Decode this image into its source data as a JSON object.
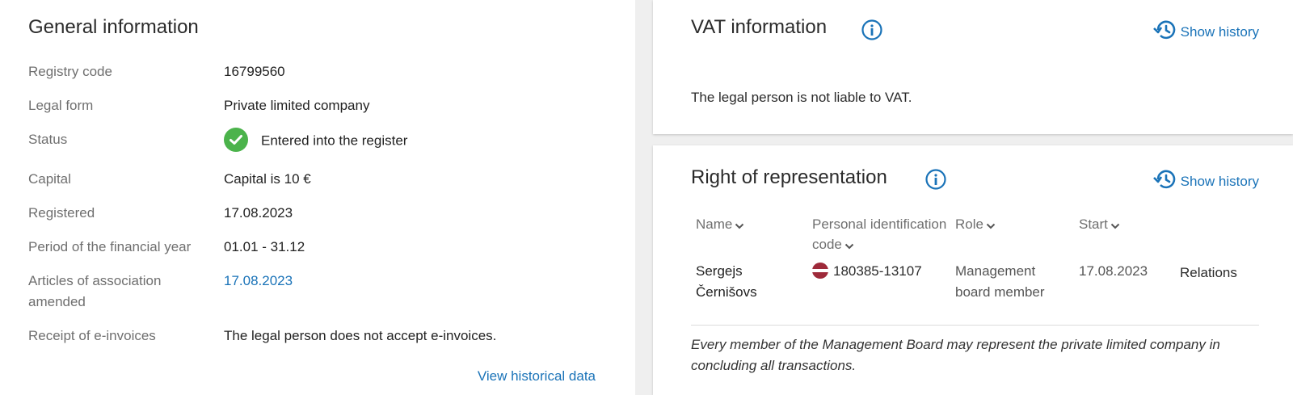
{
  "general": {
    "title": "General information",
    "rows": [
      {
        "label": "Registry code",
        "value": "16799560"
      },
      {
        "label": "Legal form",
        "value": "Private limited company"
      },
      {
        "label": "Status",
        "value": "Entered into the register"
      },
      {
        "label": "Capital",
        "value": "Capital is 10 €"
      },
      {
        "label": "Registered",
        "value": "17.08.2023"
      },
      {
        "label": "Period of the financial year",
        "value": "01.01 - 31.12"
      },
      {
        "label": "Articles of association amended",
        "value": "17.08.2023"
      },
      {
        "label": "Receipt of e-invoices",
        "value": "The legal person does not accept e-invoices."
      }
    ],
    "view_history_label": "View historical data"
  },
  "vat": {
    "title": "VAT information",
    "show_history_label": "Show history",
    "text": "The legal person is not liable to VAT."
  },
  "representation": {
    "title": "Right of representation",
    "show_history_label": "Show history",
    "columns": {
      "name": "Name",
      "personal_code": "Personal identification code",
      "role": "Role",
      "start": "Start"
    },
    "rows": [
      {
        "name": "Sergejs Černišovs",
        "personal_code": "180385-13107",
        "role": "Management board member",
        "start": "17.08.2023",
        "relations_label": "Relations"
      }
    ],
    "note": "Every member of the Management Board may represent the private limited company in concluding all transactions."
  },
  "colors": {
    "link": "#1a73b8",
    "status_ok": "#4bb34b",
    "flag": "#9e2a3a"
  },
  "icons": [
    "check-icon",
    "info-icon",
    "history-icon",
    "chevron-down-icon",
    "latvia-flag-icon"
  ]
}
